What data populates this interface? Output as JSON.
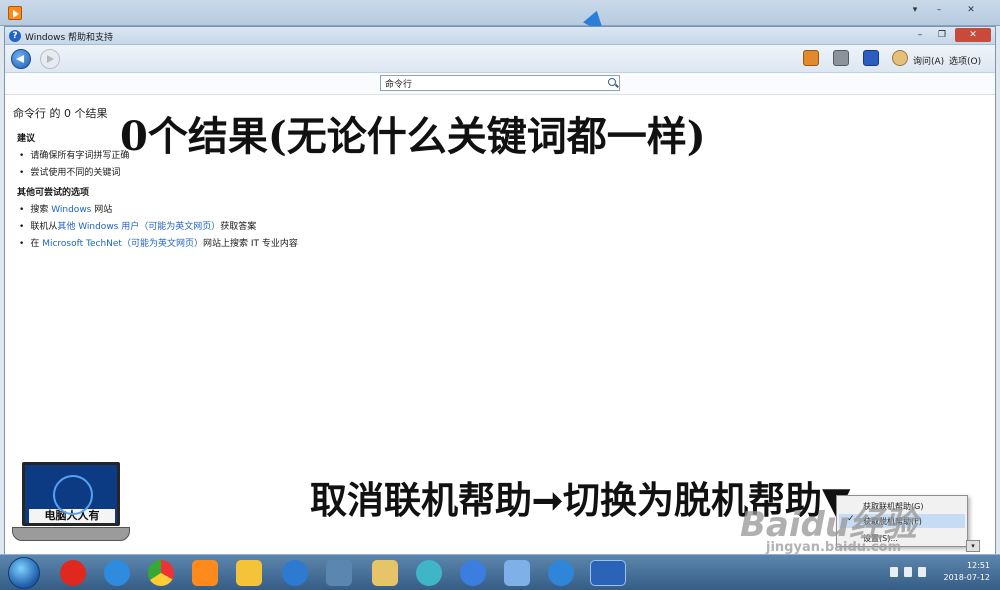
{
  "window": {
    "title": "Windows 帮助和支持",
    "minimize": "–",
    "restore": "❐",
    "close": "✕"
  },
  "outer_controls": {
    "down": "▾",
    "min": "–",
    "restore": "▫",
    "close": "✕"
  },
  "toolbar": {
    "ask_label": "询问(A)",
    "options_label": "选项(O)"
  },
  "search": {
    "value": "命令行",
    "placeholder": ""
  },
  "results": {
    "query": "命令行",
    "of": "的",
    "count_text": "0 个结果"
  },
  "suggestions": {
    "title": "建议",
    "items": [
      "请确保所有字词拼写正确",
      "尝试使用不同的关键词"
    ]
  },
  "other_options": {
    "title": "其他可尝试的选项",
    "item1": {
      "prefix": "搜索 ",
      "link": "Windows",
      "suffix": " 网站"
    },
    "item2": {
      "prefix": "联机从",
      "link": "其他 Windows 用户（可能为英文网页）",
      "suffix": "获取答案"
    },
    "item3": {
      "prefix": "在 ",
      "link": "Microsoft TechNet（可能为英文网页）",
      "suffix": "网站上搜索 IT 专业内容"
    }
  },
  "annotations": {
    "top": "0个结果(无论什么关键词都一样)",
    "bottom": "取消联机帮助➞切换为脱机帮助▼"
  },
  "logo": {
    "caption": "电脑人人有"
  },
  "context_menu": {
    "items": [
      "获取联机帮助(G)",
      "获取脱机帮助(F)",
      "设置(S)..."
    ]
  },
  "watermark": {
    "brand": "Baidu经验",
    "url": "jingyan.baidu.com"
  },
  "taskbar": {
    "time": "12:51",
    "date": "2018-07-12"
  },
  "colors": {
    "link": "#1e63c4",
    "taskbar": "#355d86",
    "accent": "#1f64c8"
  },
  "icons": [
    "back-icon",
    "forward-icon",
    "home-icon",
    "print-icon",
    "browse-help-icon",
    "ask-icon",
    "search-icon"
  ]
}
